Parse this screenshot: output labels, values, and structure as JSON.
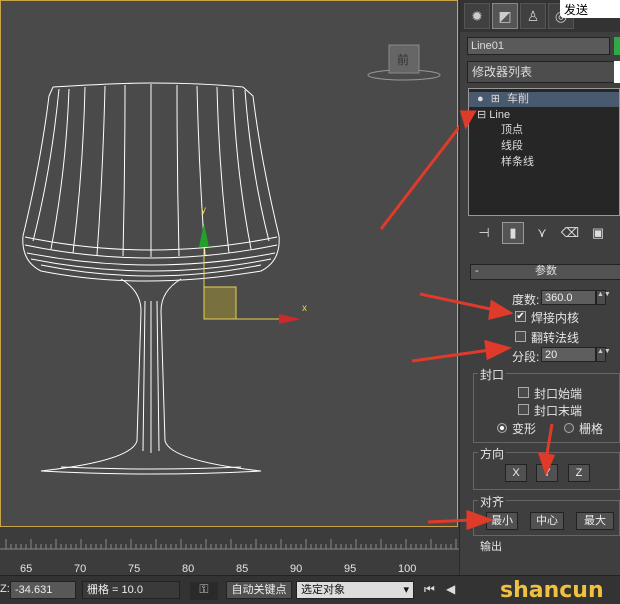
{
  "viewport": {
    "axis_y": "y",
    "axis_x": "x",
    "viewcube_label": "前"
  },
  "share_button": "发送",
  "command_panel": {
    "object_name": "Line01",
    "modifier_list": "修改器列表",
    "stack": {
      "lathe": "车削",
      "line": "Line",
      "vertex": "顶点",
      "segment": "线段",
      "spline": "样条线"
    },
    "params": {
      "rollout_title": "参数",
      "degrees_label": "度数:",
      "degrees_value": "360.0",
      "weld_core": "焊接内核",
      "weld_core_checked": "✔",
      "flip_normals": "翻转法线",
      "segments_label": "分段:",
      "segments_value": "20",
      "capping_group": "封口",
      "cap_start": "封口始端",
      "cap_end": "封口末端",
      "morph": "变形",
      "grid": "栅格",
      "direction_group": "方向",
      "dir_x": "X",
      "dir_y": "Y",
      "dir_z": "Z",
      "align_group": "对齐",
      "align_min": "最小",
      "align_center": "中心",
      "align_max": "最大",
      "output_group": "输出"
    }
  },
  "timeline": {
    "ticks": [
      "65",
      "70",
      "75",
      "80",
      "85",
      "90",
      "95",
      "100"
    ]
  },
  "statusbar": {
    "z_label": "Z:",
    "z_value": "-34.631",
    "grid_value": "栅格 = 10.0",
    "auto_key": "自动关键点",
    "selection_set": "选定对象"
  },
  "watermark": "shancun",
  "colors": {
    "viewport_border": "#c9a34a",
    "arrow_red": "#e03a2a",
    "axis_green": "#23a02a"
  }
}
